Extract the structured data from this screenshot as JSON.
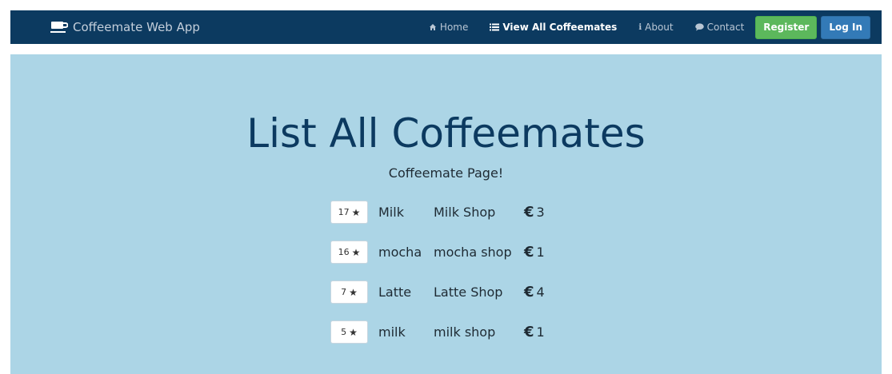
{
  "navbar": {
    "brand": "Coffeemate Web App",
    "links": [
      {
        "label": "Home",
        "icon": "home-icon"
      },
      {
        "label": "View All Coffeemates",
        "icon": "list-icon"
      },
      {
        "label": "About",
        "icon": "info-icon"
      },
      {
        "label": "Contact",
        "icon": "comment-icon"
      }
    ],
    "register_label": "Register",
    "login_label": "Log In",
    "colors": {
      "background": "#0c3a60",
      "register": "#5cb85c",
      "login": "#337ab7"
    }
  },
  "main": {
    "title": "List All Coffeemates",
    "subtitle": "Coffeemate Page!",
    "background": "#acd5e6",
    "items": [
      {
        "stars": "17",
        "name": "Milk",
        "shop": "Milk Shop",
        "currency": "€",
        "price": "3"
      },
      {
        "stars": "16",
        "name": "mocha",
        "shop": "mocha shop",
        "currency": "€",
        "price": "1"
      },
      {
        "stars": "7",
        "name": "Latte",
        "shop": "Latte Shop",
        "currency": "€",
        "price": "4"
      },
      {
        "stars": "5",
        "name": "milk",
        "shop": "milk shop",
        "currency": "€",
        "price": "1"
      }
    ]
  }
}
